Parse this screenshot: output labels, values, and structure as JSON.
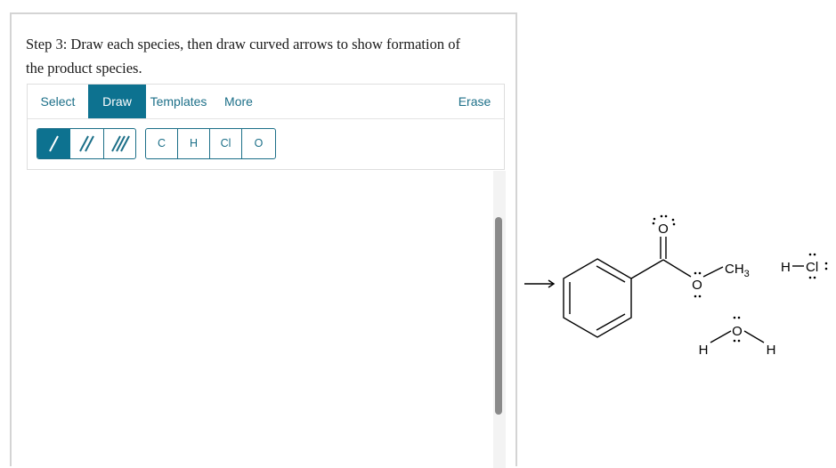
{
  "prompt": {
    "line1": "Step 3: Draw each species, then draw curved arrows to show formation of",
    "line2": "the product species."
  },
  "toolbar": {
    "tabs": [
      {
        "label": "Select"
      },
      {
        "label": "Draw"
      },
      {
        "label": "Templates"
      },
      {
        "label": "More"
      }
    ],
    "erase_label": "Erase",
    "bond_tools": [
      "single-bond",
      "double-bond",
      "triple-bond"
    ],
    "atoms": [
      "C",
      "H",
      "Cl",
      "O"
    ]
  },
  "scene": {
    "arrow": "→",
    "ester": {
      "carbonyl_o": "O",
      "ether_o": "O",
      "methyl": "CH",
      "methyl_sub": "3"
    },
    "water": {
      "o": "O",
      "h_left": "H",
      "h_right": "H"
    },
    "hcl": {
      "h": "H",
      "dash": "—",
      "cl": "Cl"
    }
  },
  "colors": {
    "accent": "#0d7290",
    "accent_text": "#1c6f88"
  }
}
